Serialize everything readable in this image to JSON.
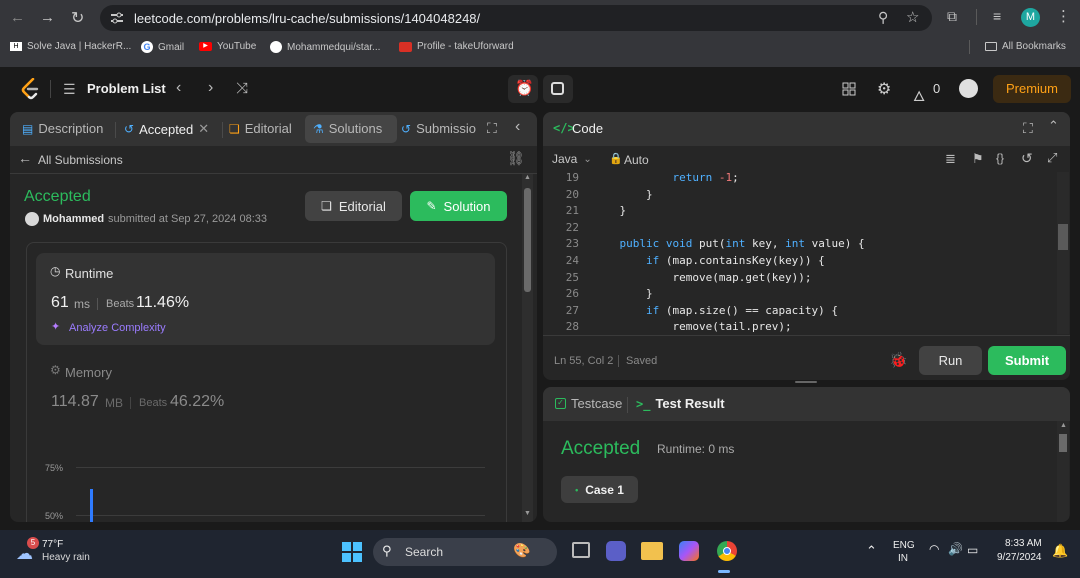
{
  "browser": {
    "url": "leetcode.com/problems/lru-cache/submissions/1404048248/",
    "profile_initial": "M",
    "bookmarks": [
      "Solve Java | HackerR...",
      "Gmail",
      "YouTube",
      "Mohammedqui/star...",
      "Profile - takeUforward"
    ],
    "all_bookmarks": "All Bookmarks"
  },
  "nav": {
    "problem_list": "Problem List",
    "streak": "0",
    "premium": "Premium"
  },
  "left_panel": {
    "tabs": [
      "Description",
      "Accepted",
      "Editorial",
      "Solutions",
      "Submissio"
    ],
    "back_label": "All Submissions",
    "status": "Accepted",
    "user": "Mohammed",
    "submitted_text": "submitted at Sep 27, 2024 08:33",
    "editorial_btn": "Editorial",
    "solution_btn": "Solution",
    "runtime": {
      "label": "Runtime",
      "value": "61",
      "unit": "ms",
      "beats_label": "Beats",
      "beats": "11.46%",
      "analyze": "Analyze Complexity"
    },
    "memory": {
      "label": "Memory",
      "value": "114.87",
      "unit": "MB",
      "beats_label": "Beats",
      "beats": "46.22%"
    },
    "chart_ticks": [
      "75%",
      "50%"
    ]
  },
  "code_panel": {
    "title": "Code",
    "language": "Java",
    "mode": "Auto",
    "lines": [
      {
        "n": "19",
        "text": "            return -1;"
      },
      {
        "n": "20",
        "text": "        }"
      },
      {
        "n": "21",
        "text": "    }"
      },
      {
        "n": "22",
        "text": ""
      },
      {
        "n": "23",
        "text": "    public void put(int key, int value) {"
      },
      {
        "n": "24",
        "text": "        if (map.containsKey(key)) {"
      },
      {
        "n": "25",
        "text": "            remove(map.get(key));"
      },
      {
        "n": "26",
        "text": "        }"
      },
      {
        "n": "27",
        "text": "        if (map.size() == capacity) {"
      },
      {
        "n": "28",
        "text": "            remove(tail.prev);"
      }
    ],
    "cursor": "Ln 55, Col 2",
    "saved": "Saved",
    "run": "Run",
    "submit": "Submit"
  },
  "test_panel": {
    "tab_testcase": "Testcase",
    "tab_result": "Test Result",
    "status": "Accepted",
    "runtime": "Runtime: 0 ms",
    "case": "Case 1"
  },
  "taskbar": {
    "badge": "5",
    "temp": "77°F",
    "weather": "Heavy rain",
    "search": "Search",
    "lang": "ENG",
    "region": "IN",
    "time": "8:33 AM",
    "date": "9/27/2024"
  },
  "colors": {
    "accent_green": "#2cbb5d",
    "premium": "#ffa116",
    "keyword": "#4fb0ff"
  }
}
